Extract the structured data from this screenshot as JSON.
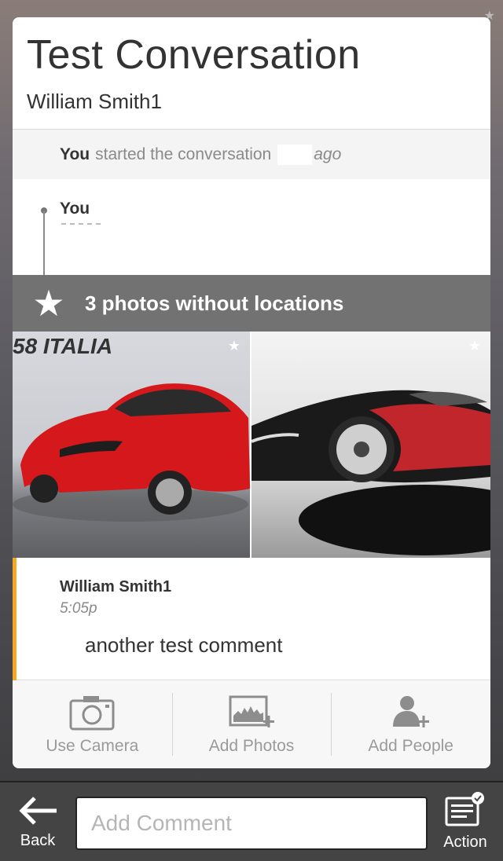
{
  "conversation": {
    "title": "Test Conversation",
    "subtitle": "William Smith1"
  },
  "started": {
    "actor": "You",
    "text": "started the conversation",
    "ago": "ago"
  },
  "timeline_entry": {
    "name": "You"
  },
  "photos_section": {
    "label": "3 photos without locations",
    "photos": [
      {
        "subject": "red sports car",
        "badge_text": "58 ITALIA"
      },
      {
        "subject": "black and red concept car"
      }
    ]
  },
  "comment": {
    "author": "William Smith1",
    "time": "5:05p",
    "text": "another test comment"
  },
  "actions": [
    {
      "label": "Use Camera",
      "icon": "camera-icon"
    },
    {
      "label": "Add Photos",
      "icon": "add-photos-icon"
    },
    {
      "label": "Add People",
      "icon": "add-people-icon"
    }
  ],
  "bottom_bar": {
    "back_label": "Back",
    "comment_placeholder": "Add Comment",
    "action_label": "Action"
  },
  "colors": {
    "accent": "#f5a623",
    "photos_bar": "#727272"
  }
}
